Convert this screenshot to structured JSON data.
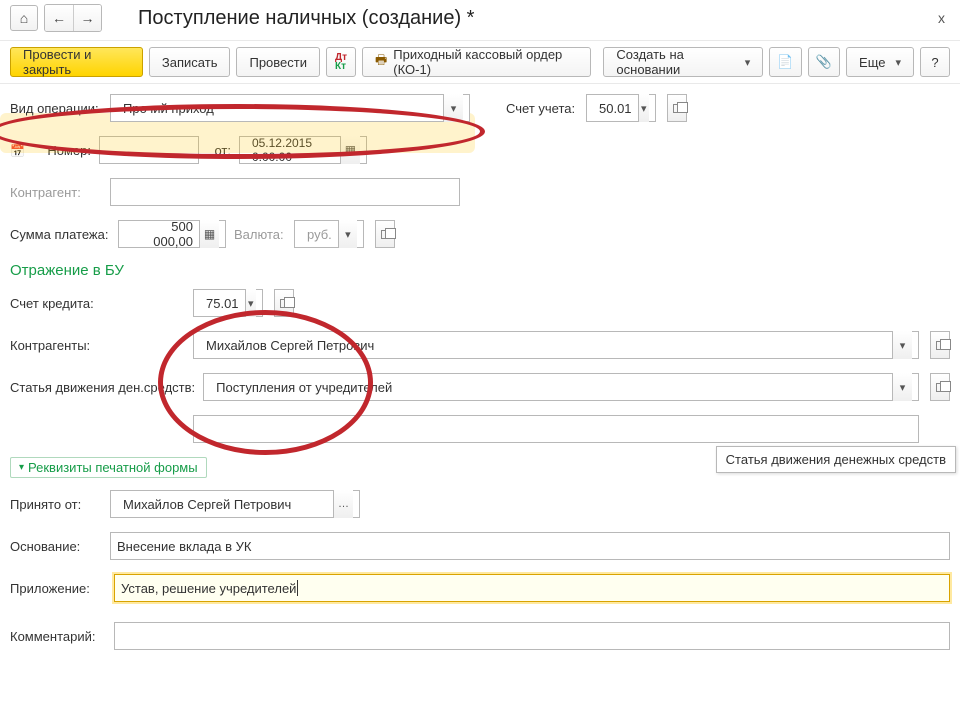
{
  "page_title": "Поступление наличных (создание) *",
  "toolbar": {
    "post_close": "Провести и закрыть",
    "save": "Записать",
    "post": "Провести",
    "ko1": "Приходный кассовый ордер (КО-1)",
    "based": "Создать на основании",
    "more": "Еще",
    "help": "?"
  },
  "op": {
    "label": "Вид операции:",
    "value": "Прочий приход",
    "acc_label": "Счет учета:",
    "acc_value": "50.01"
  },
  "num": {
    "label": "Номер:",
    "from_label": "от:",
    "date_value": "05.12.2015  0:00:00"
  },
  "contragent_label": "Контрагент:",
  "sum": {
    "label": "Сумма платежа:",
    "value": "500 000,00",
    "cur_label": "Валюта:",
    "cur_value": "руб."
  },
  "bu_title": "Отражение в БУ",
  "credit": {
    "label": "Счет кредита:",
    "value": "75.01"
  },
  "contragents": {
    "label": "Контрагенты:",
    "value": "Михайлов Сергей Петрович"
  },
  "dds": {
    "label": "Статья движения ден.средств:",
    "value": "Поступления от учредителей"
  },
  "print_title": "Реквизиты печатной формы",
  "taken": {
    "label": "Принято от:",
    "value": "Михайлов Сергей Петрович"
  },
  "basis": {
    "label": "Основание:",
    "value": "Внесение вклада в УК"
  },
  "attach": {
    "label": "Приложение:",
    "value": "Устав, решение учредителей"
  },
  "comment_label": "Комментарий:",
  "tooltip": "Статья движения денежных средств"
}
